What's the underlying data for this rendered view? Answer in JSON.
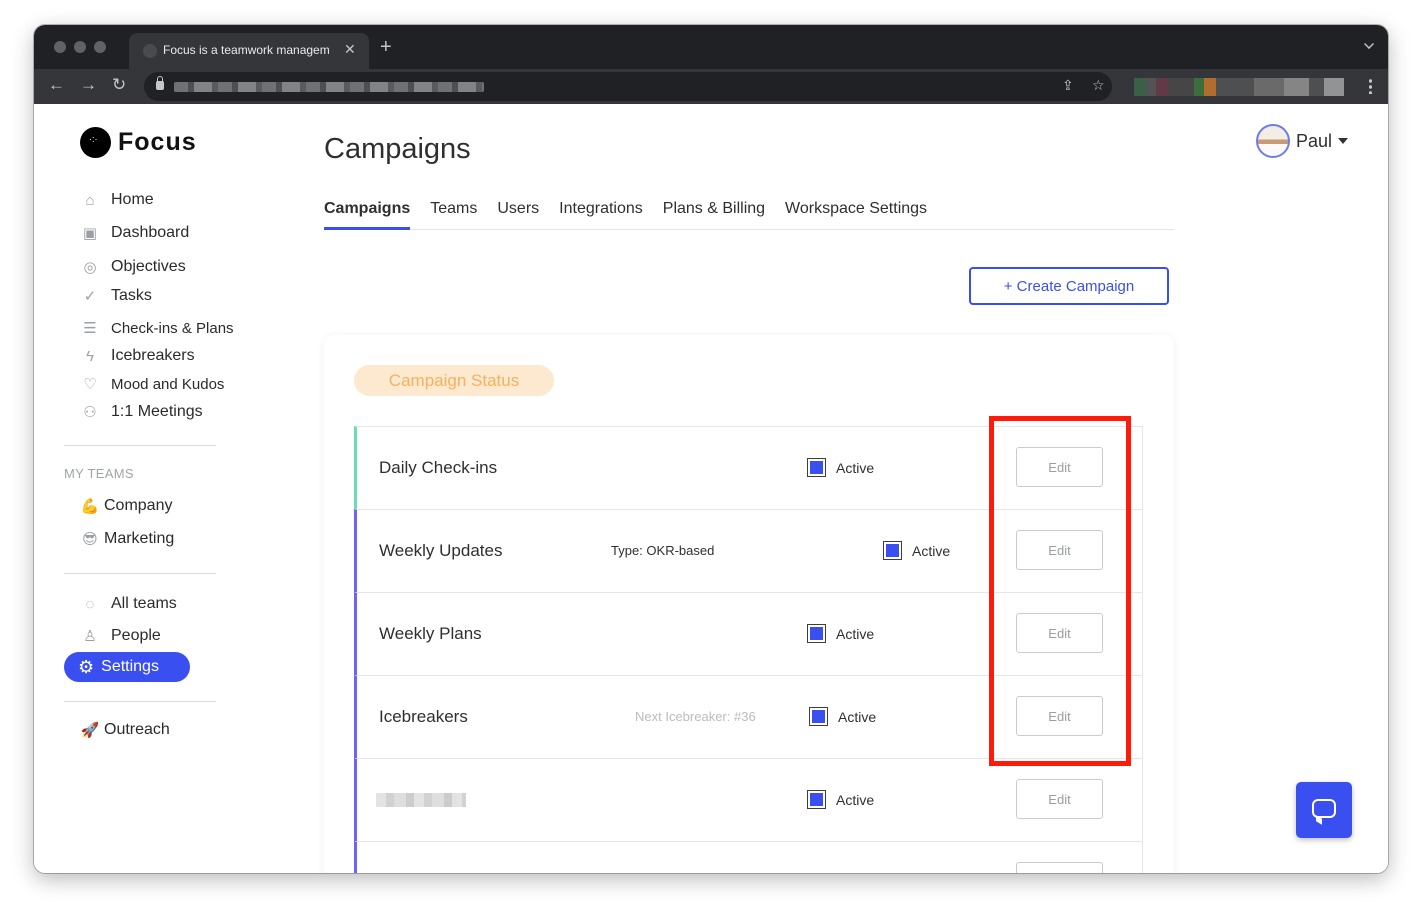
{
  "browser": {
    "tab_title": "Focus is a teamwork managem",
    "tab_close": "✕",
    "new_tab": "+"
  },
  "app": {
    "logo_text": "Focus"
  },
  "user": {
    "name": "Paul"
  },
  "sidebar": {
    "nav": [
      {
        "label": "Home",
        "icon": "home-icon"
      },
      {
        "label": "Dashboard",
        "icon": "dashboard-icon"
      },
      {
        "label": "Objectives",
        "icon": "target-icon"
      },
      {
        "label": "Tasks",
        "icon": "check-circle-icon"
      },
      {
        "label": "Check-ins & Plans",
        "icon": "checkin-icon"
      },
      {
        "label": "Icebreakers",
        "icon": "lightning-icon"
      },
      {
        "label": "Mood and Kudos",
        "icon": "heart-icon"
      },
      {
        "label": "1:1 Meetings",
        "icon": "people-icon"
      }
    ],
    "my_teams_label": "MY TEAMS",
    "teams": [
      {
        "label": "Company",
        "emoji": "💪"
      },
      {
        "label": "Marketing",
        "emoji": "😎"
      }
    ],
    "all_teams": "All teams",
    "people": "People",
    "settings": "Settings",
    "outreach": "Outreach",
    "outreach_emoji": "🚀"
  },
  "main": {
    "title": "Campaigns",
    "tabs": [
      "Campaigns",
      "Teams",
      "Users",
      "Integrations",
      "Plans & Billing",
      "Workspace Settings"
    ],
    "active_tab": "Campaigns",
    "create_button": "+ Create Campaign",
    "status_pill": "Campaign Status",
    "campaigns": [
      {
        "name": "Daily Check-ins",
        "meta": "",
        "status": "Active",
        "checked": true,
        "edit": "Edit"
      },
      {
        "name": "Weekly Updates",
        "meta": "Type: OKR-based",
        "status": "Active",
        "checked": true,
        "edit": "Edit"
      },
      {
        "name": "Weekly Plans",
        "meta": "",
        "status": "Active",
        "checked": true,
        "edit": "Edit"
      },
      {
        "name": "Icebreakers",
        "meta": "Next Icebreaker: #36",
        "status": "Active",
        "checked": true,
        "edit": "Edit"
      },
      {
        "name": "",
        "meta": "",
        "status": "Active",
        "checked": true,
        "edit": "Edit"
      }
    ]
  },
  "colors": {
    "accent": "#3a4ff0",
    "highlight": "#ff1a0a",
    "status_pill_bg": "#fde9cf",
    "status_pill_text": "#f5b25c",
    "row_accent_first": "#6ddcb6",
    "row_accent": "#6c63ff"
  }
}
